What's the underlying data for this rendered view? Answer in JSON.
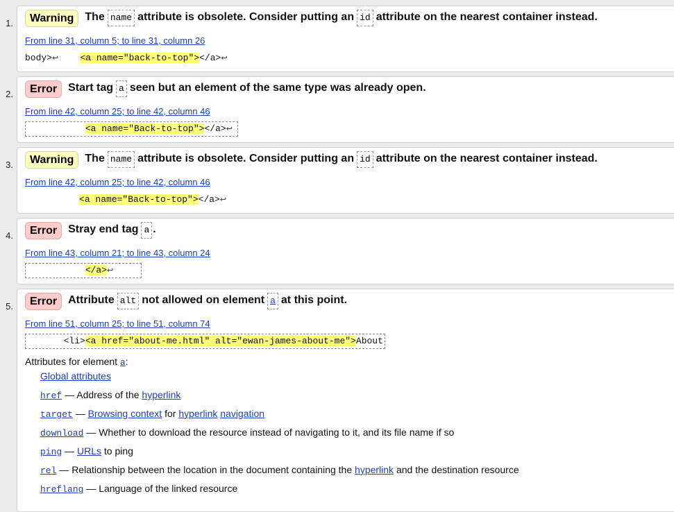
{
  "items": [
    {
      "num": "1.",
      "type": "Warning",
      "msg_parts": [
        "The",
        "name",
        "attribute is obsolete. Consider putting an",
        "id",
        "attribute on the nearest container instead."
      ],
      "location": "From line 31, column 5; to line 31, column 26",
      "extract": {
        "pre": "body>",
        "ret1": "↩",
        "mid": "    ",
        "hl": "<a name=\"back-to-top\">",
        "post": "</a>",
        "ret2": "↩"
      }
    },
    {
      "num": "2.",
      "type": "Error",
      "msg_parts": [
        "Start tag",
        "a",
        "seen but an element of the same type was already open."
      ],
      "location": "From line 42, column 25; to line 42, column 46",
      "extract": {
        "pre": "           ",
        "hl": "<a name=\"Back-to-top\">",
        "post": "</a>",
        "ret2": "↩"
      }
    },
    {
      "num": "3.",
      "type": "Warning",
      "msg_parts": [
        "The",
        "name",
        "attribute is obsolete. Consider putting an",
        "id",
        "attribute on the nearest container instead."
      ],
      "location": "From line 42, column 25; to line 42, column 46",
      "extract": {
        "pre": "          ",
        "hl": "<a name=\"Back-to-top\">",
        "post": "</a>",
        "ret2": "↩"
      }
    },
    {
      "num": "4.",
      "type": "Error",
      "msg_parts": [
        "Stray end tag",
        "a",
        "."
      ],
      "location": "From line 43, column 21; to line 43, column 24",
      "extract": {
        "pre": "           ",
        "hl": "</a>",
        "post": "",
        "ret2": "↩"
      }
    },
    {
      "num": "5.",
      "type": "Error",
      "msg_parts": [
        "Attribute",
        "alt",
        "not allowed on element",
        "a",
        "at this point."
      ],
      "location": "From line 51, column 25; to line 51, column 74",
      "extract": {
        "pre": "       <li>",
        "hl": "<a href=\"about-me.html\" alt=\"ewan-james-about-me\">",
        "post": "About"
      },
      "attrs_title": "Attributes for element",
      "attrs_el": "a",
      "attrs_colon": ":",
      "attrs": [
        {
          "name": "",
          "link": "Global attributes"
        },
        {
          "name": "href",
          "sep": " — ",
          "desc": "Address of the",
          "link": "hyperlink"
        },
        {
          "name": "target",
          "sep": " — ",
          "link": "Browsing context",
          "desc2": " for ",
          "link2": "hyperlink",
          "link3": "navigation"
        },
        {
          "name": "download",
          "sep": " — ",
          "desc": "Whether to download the resource instead of navigating to it, and its file name if so"
        },
        {
          "name": "ping",
          "sep": " — ",
          "link": "URLs",
          "desc2": " to ping"
        },
        {
          "name": "rel",
          "sep": " — ",
          "desc": "Relationship between the location in the document containing the",
          "link": "hyperlink",
          "desc2": " and the destination resource"
        },
        {
          "name": "hreflang",
          "sep": " — ",
          "desc": "Language of the linked resource"
        }
      ]
    }
  ]
}
